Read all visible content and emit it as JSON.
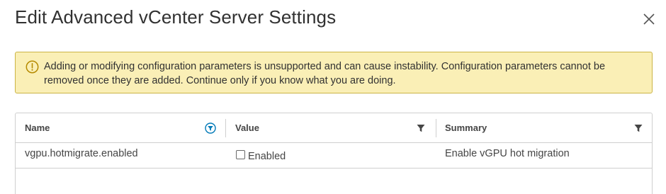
{
  "dialog": {
    "title": "Edit Advanced vCenter Server Settings",
    "close_icon": "close-icon"
  },
  "alert": {
    "icon": "warning-circle-icon",
    "text": "Adding or modifying configuration parameters is unsupported and can cause instability. Configuration parameters cannot be removed once they are added. Continue only if you know what you are doing."
  },
  "grid": {
    "columns": [
      {
        "label": "Name",
        "filter_icon": "filter-active-icon"
      },
      {
        "label": "Value",
        "filter_icon": "filter-icon"
      },
      {
        "label": "Summary",
        "filter_icon": "filter-icon"
      }
    ],
    "rows": [
      {
        "name": "vgpu.hotmigrate.enabled",
        "value_label": "Enabled",
        "value_checked": false,
        "summary": "Enable vGPU hot migration"
      }
    ]
  },
  "colors": {
    "alert_bg": "#faefb6",
    "alert_border": "#cbb445",
    "warning_icon": "#b58a00",
    "filter_active": "#0079b8"
  }
}
